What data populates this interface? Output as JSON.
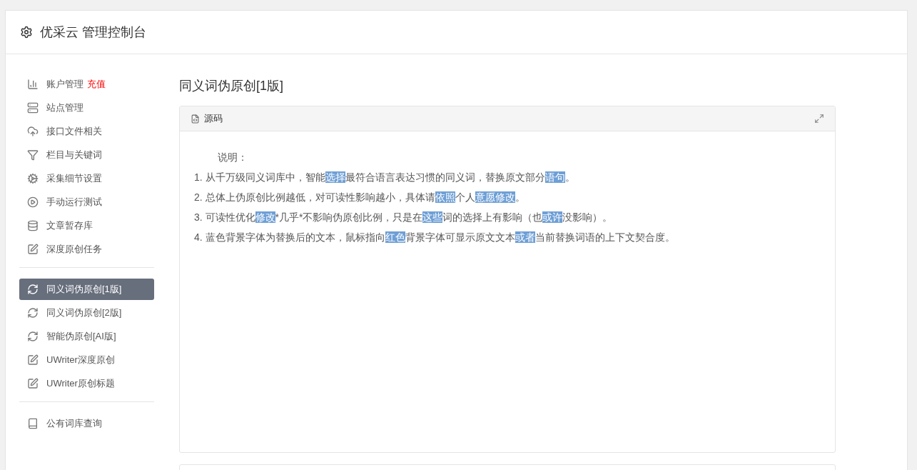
{
  "header": {
    "title": "优采云 管理控制台"
  },
  "sidebar": {
    "groups": [
      {
        "items": [
          {
            "label": "账户管理",
            "badge": "充值",
            "selected": false
          },
          {
            "label": "站点管理",
            "selected": false
          },
          {
            "label": "接口文件相关",
            "selected": false
          },
          {
            "label": "栏目与关键词",
            "selected": false
          },
          {
            "label": "采集细节设置",
            "selected": false
          },
          {
            "label": "手动运行测试",
            "selected": false
          },
          {
            "label": "文章暂存库",
            "selected": false
          },
          {
            "label": "深度原创任务",
            "selected": false
          }
        ]
      },
      {
        "items": [
          {
            "label": "同义词伪原创[1版]",
            "selected": true
          },
          {
            "label": "同义词伪原创[2版]",
            "selected": false
          },
          {
            "label": "智能伪原创[AI版]",
            "selected": false
          },
          {
            "label": "UWriter深度原创",
            "selected": false
          },
          {
            "label": "UWriter原创标题",
            "selected": false
          }
        ]
      },
      {
        "items": [
          {
            "label": "公有词库查询",
            "selected": false
          }
        ]
      }
    ]
  },
  "content": {
    "title": "同义词伪原创[1版]",
    "panel": {
      "tab": "源码",
      "heading": "说明：",
      "lines": [
        [
          {
            "text": "1. 从千万级同义词库中，智能",
            "highlighted": false
          },
          {
            "text": "选择",
            "highlighted": true
          },
          {
            "text": "最符合语言表达习惯的同义词，替换原文部分",
            "highlighted": false
          },
          {
            "text": "语句",
            "highlighted": true
          },
          {
            "text": "。",
            "highlighted": false
          }
        ],
        [
          {
            "text": "2. 总体上伪原创比例越低，对可读性影响越小，具体请",
            "highlighted": false
          },
          {
            "text": "依照",
            "highlighted": true
          },
          {
            "text": "个人",
            "highlighted": false
          },
          {
            "text": "意愿",
            "highlighted": true
          },
          {
            "text": "修改",
            "highlighted": true
          },
          {
            "text": "。",
            "highlighted": false
          }
        ],
        [
          {
            "text": "3. 可读性优化",
            "highlighted": false
          },
          {
            "text": "修改",
            "highlighted": true
          },
          {
            "text": "*几乎*不影响伪原创比例，只是在",
            "highlighted": false
          },
          {
            "text": "这些",
            "highlighted": true
          },
          {
            "text": "词的选择上有影响（也",
            "highlighted": false
          },
          {
            "text": "或许",
            "highlighted": true
          },
          {
            "text": "没影响）。",
            "highlighted": false
          }
        ],
        [
          {
            "text": "4. 蓝色背景字体为替换后的文本，鼠标指向",
            "highlighted": false
          },
          {
            "text": "红色",
            "highlighted": true
          },
          {
            "text": "背景字体可显示原文文本",
            "highlighted": false
          },
          {
            "text": "或者",
            "highlighted": true
          },
          {
            "text": "当前替换词语的上下文契合度。",
            "highlighted": false
          }
        ]
      ]
    }
  }
}
